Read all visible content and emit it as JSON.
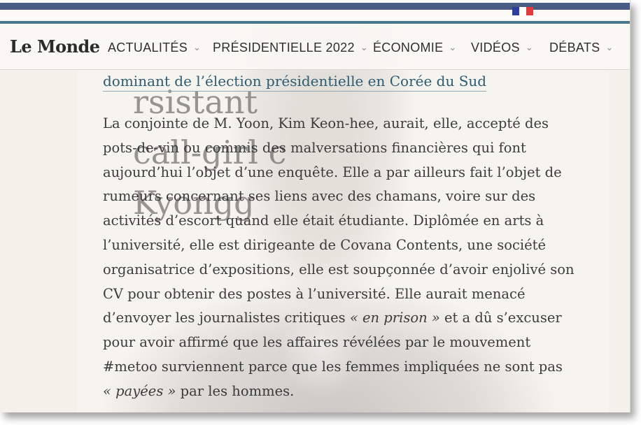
{
  "header": {
    "logo": "Le Monde",
    "nav_items": [
      {
        "label": "ACTUALITÉS"
      },
      {
        "label": "PRÉSIDENTIELLE 2022"
      },
      {
        "label": "ÉCONOMIE"
      },
      {
        "label": "VIDÉOS"
      },
      {
        "label": "DÉBATS"
      }
    ],
    "chevron": "⌄"
  },
  "overlay_text": {
    "line1": "rsistant",
    "line2": "call-girl c",
    "line3": "Kyongg"
  },
  "article": {
    "link_text": "dominant de l’élection présidentielle en Corée du Sud",
    "paragraph_lines": [
      "La conjointe de M. Yoon, Kim Keon-hee, aurait, elle, accepté des",
      "pots-de-vin ou commis des malversations financières qui font",
      "aujourd’hui l’objet d’une enquête. Elle a par ailleurs fait l’objet de",
      "rumeurs concernant ses liens avec des chamans, voire sur des",
      "activités d’escort quand elle était étudiante. Diplômée en arts à",
      "l’université, elle est dirigeante de Covana Contents, une société",
      "organisatrice d’expositions, elle est soupçonnée d’avoir enjolivé son",
      "CV pour obtenir des postes à l’université. Elle aurait menacé"
    ],
    "line9_before": "d’envoyer les journalistes critiques ",
    "line9_em": "« en prison »",
    "line9_after": " et a dû s’excuser",
    "line10": "pour avoir affirmé que les affaires révélées par le mouvement",
    "line11": "#metoo surviennent parce que les femmes impliquées ne sont pas",
    "line12_em": "« payées »",
    "line12_after": " par les hommes."
  },
  "colors": {
    "accent": "#4a7789",
    "link": "#2d5b73",
    "topbar": "#4b5c84"
  }
}
